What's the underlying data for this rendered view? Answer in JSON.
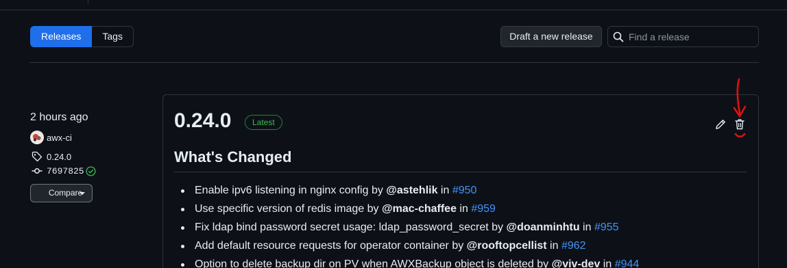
{
  "nav": {
    "tabs": [
      {
        "label": "Releases",
        "selected": true
      },
      {
        "label": "Tags",
        "selected": false
      }
    ]
  },
  "actions": {
    "draft_button": "Draft a new release",
    "search_placeholder": "Find a release",
    "search_icon": "search-icon"
  },
  "release": {
    "time": "2 hours ago",
    "author": "awx-ci",
    "tag": "0.24.0",
    "commit": "7697825",
    "commit_verified": true,
    "compare_label": "Compare",
    "title": "0.24.0",
    "badge": "Latest",
    "icons": {
      "edit": "pencil-icon",
      "delete": "trash-icon"
    },
    "heading": "What's Changed",
    "changes": [
      {
        "text": "Enable ipv6 listening in nginx config by ",
        "author": "@astehlik",
        "mid": " in ",
        "pr": "#950"
      },
      {
        "text": "Use specific version of redis image by ",
        "author": "@mac-chaffee",
        "mid": " in ",
        "pr": "#959"
      },
      {
        "text": "Fix ldap bind password secret usage: ldap_password_secret by ",
        "author": "@doanminhtu",
        "mid": " in ",
        "pr": "#955"
      },
      {
        "text": "Add default resource requests for operator container by ",
        "author": "@rooftopcellist",
        "mid": " in ",
        "pr": "#962"
      },
      {
        "text": "Option to delete backup dir on PV when AWXBackup object is deleted by ",
        "author": "@viv-dev",
        "mid": " in ",
        "pr": "#944"
      }
    ]
  },
  "colors": {
    "background": "#0d1117",
    "accent": "#1f6feb",
    "link": "#4493f8",
    "success": "#3fb950",
    "annotation": "#e01010"
  }
}
